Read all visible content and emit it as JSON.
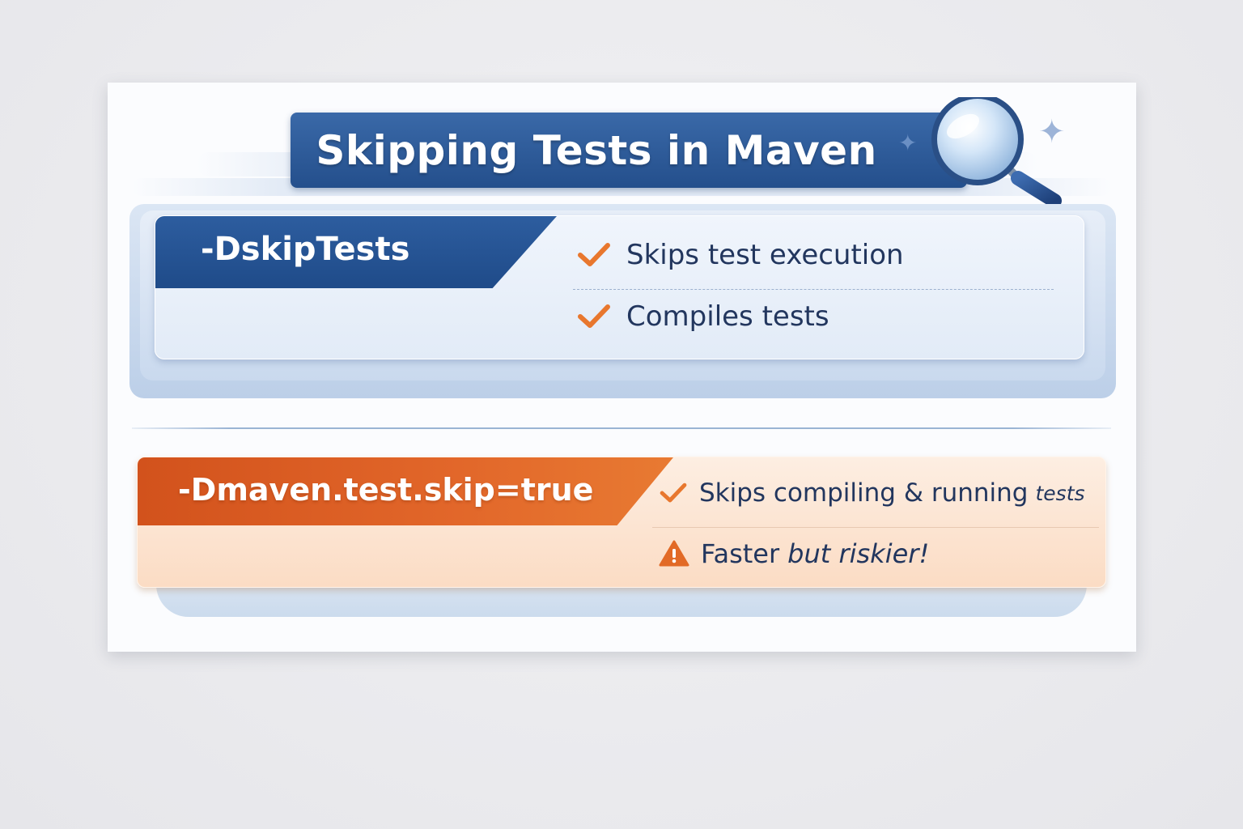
{
  "title": "Skipping Tests in Maven",
  "colors": {
    "blue_accent": "#244f8c",
    "orange_accent": "#d9581f",
    "check_color": "#e8772e",
    "text_dark": "#22365e"
  },
  "icons": {
    "title_icon": "magnifying-glass-icon",
    "decor": "sparkle-icon",
    "check": "checkmark-icon",
    "warning": "warning-triangle-icon"
  },
  "options": [
    {
      "flag": "-DskipTests",
      "items": [
        {
          "icon": "checkmark-icon",
          "text": "Skips test execution"
        },
        {
          "icon": "checkmark-icon",
          "text": "Compiles tests"
        }
      ]
    },
    {
      "flag": "-Dmaven.test.skip=true",
      "items": [
        {
          "icon": "checkmark-icon",
          "text": "Skips compiling & running",
          "text_suffix": "tests"
        },
        {
          "icon": "warning-triangle-icon",
          "text": "Faster",
          "text_suffix": "but riskier!"
        }
      ]
    }
  ]
}
